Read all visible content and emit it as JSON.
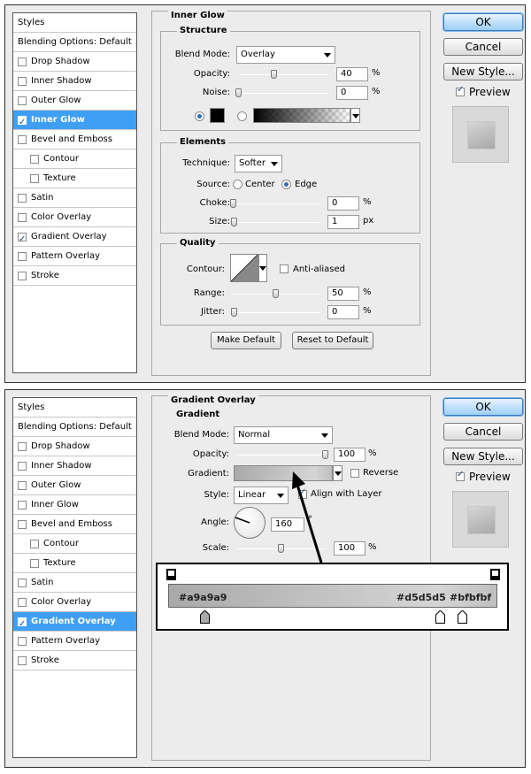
{
  "dialog1": {
    "styles_list": [
      {
        "label": "Styles",
        "type": "hdr",
        "checked": null
      },
      {
        "label": "Blending Options: Default",
        "type": "hdr",
        "checked": null
      },
      {
        "label": "Drop Shadow",
        "checked": false
      },
      {
        "label": "Inner Shadow",
        "checked": false
      },
      {
        "label": "Outer Glow",
        "checked": false
      },
      {
        "label": "Inner Glow",
        "checked": true,
        "selected": true
      },
      {
        "label": "Bevel and Emboss",
        "checked": false
      },
      {
        "label": "Contour",
        "checked": false,
        "indent": true
      },
      {
        "label": "Texture",
        "checked": false,
        "indent": true
      },
      {
        "label": "Satin",
        "checked": false
      },
      {
        "label": "Color Overlay",
        "checked": false
      },
      {
        "label": "Gradient Overlay",
        "checked": true
      },
      {
        "label": "Pattern Overlay",
        "checked": false
      },
      {
        "label": "Stroke",
        "checked": false
      }
    ],
    "panel_title": "Inner Glow",
    "structure": {
      "title": "Structure",
      "blend_mode_label": "Blend Mode:",
      "blend_mode": "Overlay",
      "opacity_label": "Opacity:",
      "opacity": "40",
      "opacity_level": 0.4,
      "noise_label": "Noise:",
      "noise": "0",
      "noise_level": 0,
      "unit": "%"
    },
    "elements": {
      "title": "Elements",
      "technique_label": "Technique:",
      "technique": "Softer",
      "source_label": "Source:",
      "source_center": "Center",
      "source_edge": "Edge",
      "choke_label": "Choke:",
      "choke": "0",
      "choke_unit": "%",
      "size_label": "Size:",
      "size": "1",
      "size_unit": "px"
    },
    "quality": {
      "title": "Quality",
      "contour_label": "Contour:",
      "anti_aliased": "Anti-aliased",
      "range_label": "Range:",
      "range": "50",
      "range_level": 0.5,
      "jitter_label": "Jitter:",
      "jitter": "0",
      "unit": "%"
    },
    "make_default": "Make Default",
    "reset_default": "Reset to Default"
  },
  "dialog2": {
    "styles_list": [
      {
        "label": "Styles",
        "type": "hdr",
        "checked": null
      },
      {
        "label": "Blending Options: Default",
        "type": "hdr",
        "checked": null
      },
      {
        "label": "Drop Shadow",
        "checked": false
      },
      {
        "label": "Inner Shadow",
        "checked": false
      },
      {
        "label": "Outer Glow",
        "checked": false
      },
      {
        "label": "Inner Glow",
        "checked": false
      },
      {
        "label": "Bevel and Emboss",
        "checked": false
      },
      {
        "label": "Contour",
        "checked": false,
        "indent": true
      },
      {
        "label": "Texture",
        "checked": false,
        "indent": true
      },
      {
        "label": "Satin",
        "checked": false
      },
      {
        "label": "Color Overlay",
        "checked": false
      },
      {
        "label": "Gradient Overlay",
        "checked": true,
        "selected": true
      },
      {
        "label": "Pattern Overlay",
        "checked": false
      },
      {
        "label": "Stroke",
        "checked": false
      }
    ],
    "panel_title": "Gradient Overlay",
    "gradient": {
      "title": "Gradient",
      "blend_mode_label": "Blend Mode:",
      "blend_mode": "Normal",
      "opacity_label": "Opacity:",
      "opacity": "100",
      "opacity_level": 1.0,
      "unit": "%",
      "gradient_label": "Gradient:",
      "reverse": "Reverse",
      "style_label": "Style:",
      "style": "Linear",
      "align_with_layer": "Align with Layer",
      "angle_label": "Angle:",
      "angle": "160",
      "angle_unit": "°",
      "scale_label": "Scale:",
      "scale": "100",
      "scale_level": 0.5
    },
    "gradient_editor": {
      "stop1": "#a9a9a9",
      "stop2": "#d5d5d5",
      "stop3": "#bfbfbf"
    }
  },
  "buttons": {
    "ok": "OK",
    "cancel": "Cancel",
    "new_style": "New Style...",
    "preview": "Preview"
  },
  "colors": {
    "selection": "#3f9ff5",
    "panel_bg": "#ececec",
    "gradient_start": "#a9a9a9",
    "gradient_mid": "#d5d5d5",
    "gradient_end": "#bfbfbf"
  }
}
